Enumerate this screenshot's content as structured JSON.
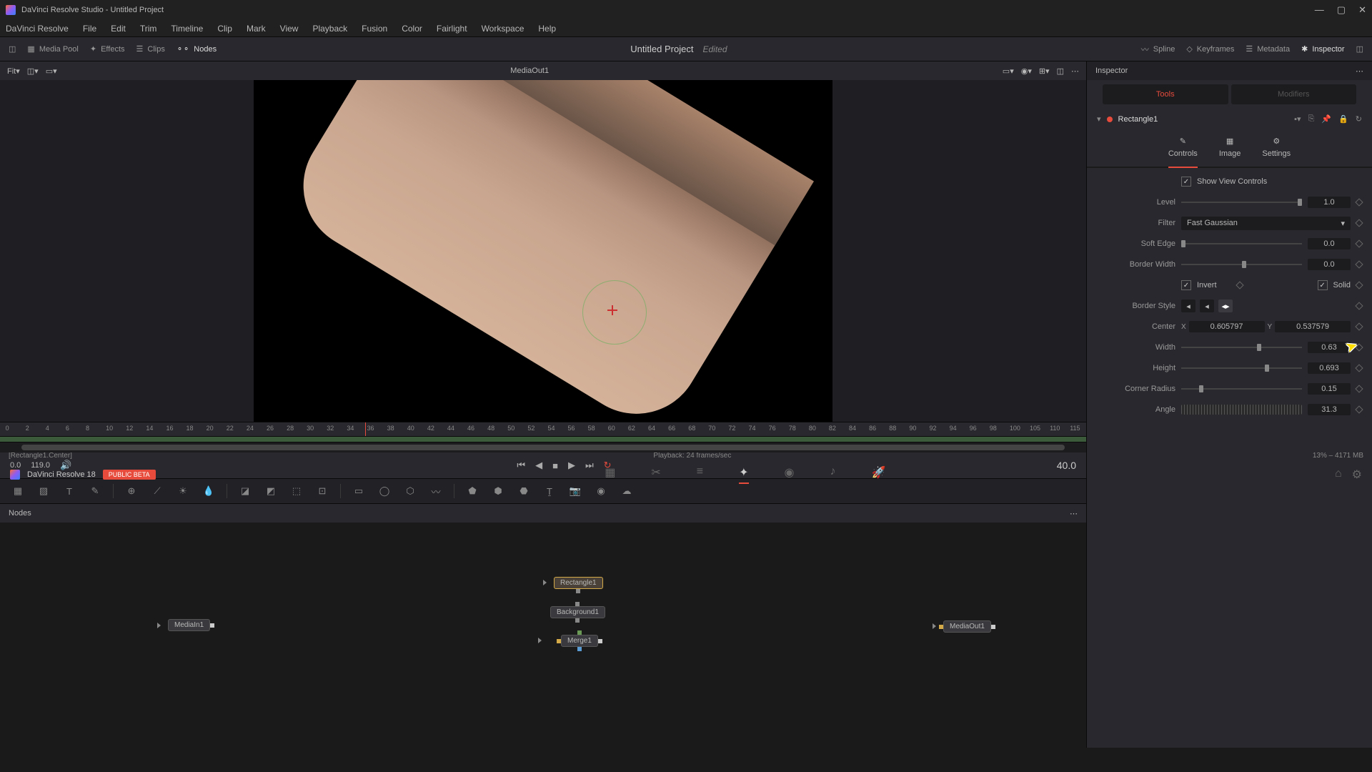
{
  "window_title": "DaVinci Resolve Studio - Untitled Project",
  "menu": [
    "DaVinci Resolve",
    "File",
    "Edit",
    "Trim",
    "Timeline",
    "Clip",
    "Mark",
    "View",
    "Playback",
    "Fusion",
    "Color",
    "Fairlight",
    "Workspace",
    "Help"
  ],
  "toolbar_left": [
    {
      "name": "media-pool",
      "label": "Media Pool"
    },
    {
      "name": "effects",
      "label": "Effects"
    },
    {
      "name": "clips",
      "label": "Clips"
    },
    {
      "name": "nodes",
      "label": "Nodes",
      "active": true
    }
  ],
  "project_title": "Untitled Project",
  "project_status": "Edited",
  "toolbar_right": [
    {
      "name": "spline",
      "label": "Spline"
    },
    {
      "name": "keyframes",
      "label": "Keyframes"
    },
    {
      "name": "metadata",
      "label": "Metadata"
    },
    {
      "name": "inspector",
      "label": "Inspector",
      "active": true
    }
  ],
  "viewer": {
    "fit": "Fit",
    "media_out": "MediaOut1"
  },
  "inspector": {
    "title": "Inspector",
    "tabs": {
      "tools": "Tools",
      "modifiers": "Modifiers"
    },
    "node_name": "Rectangle1",
    "ctrl_tabs": {
      "controls": "Controls",
      "image": "Image",
      "settings": "Settings"
    },
    "show_view": "Show View Controls",
    "level": {
      "label": "Level",
      "value": "1.0"
    },
    "filter": {
      "label": "Filter",
      "value": "Fast Gaussian"
    },
    "soft_edge": {
      "label": "Soft Edge",
      "value": "0.0"
    },
    "border_width": {
      "label": "Border Width",
      "value": "0.0"
    },
    "invert": {
      "label": "Invert"
    },
    "solid": {
      "label": "Solid"
    },
    "border_style": {
      "label": "Border Style"
    },
    "center": {
      "label": "Center",
      "x": "0.605797",
      "y": "0.537579"
    },
    "width": {
      "label": "Width",
      "value": "0.63"
    },
    "height": {
      "label": "Height",
      "value": "0.693"
    },
    "corner_radius": {
      "label": "Corner Radius",
      "value": "0.15"
    },
    "angle": {
      "label": "Angle",
      "value": "31.3"
    }
  },
  "ruler_ticks": [
    "0",
    "2",
    "4",
    "6",
    "8",
    "10",
    "12",
    "14",
    "16",
    "18",
    "20",
    "22",
    "24",
    "26",
    "28",
    "30",
    "32",
    "34",
    "36",
    "38",
    "40",
    "42",
    "44",
    "46",
    "48",
    "50",
    "52",
    "54",
    "56",
    "58",
    "60",
    "62",
    "64",
    "66",
    "68",
    "70",
    "72",
    "74",
    "76",
    "78",
    "80",
    "82",
    "84",
    "86",
    "88",
    "90",
    "92",
    "94",
    "96",
    "98",
    "100",
    "105",
    "110",
    "115"
  ],
  "playback": {
    "start": "0.0",
    "end": "119.0",
    "current": "40.0",
    "fps": "Playback: 24 frames/sec"
  },
  "nodes_panel": {
    "title": "Nodes"
  },
  "graph": {
    "rectangle": "Rectangle1",
    "background": "Background1",
    "mediain": "MediaIn1",
    "merge": "Merge1",
    "mediaout": "MediaOut1"
  },
  "status_left": "[Rectangle1.Center]",
  "status_right": "13% – 4171 MB",
  "footer": {
    "app": "DaVinci Resolve 18",
    "beta": "PUBLIC BETA"
  }
}
